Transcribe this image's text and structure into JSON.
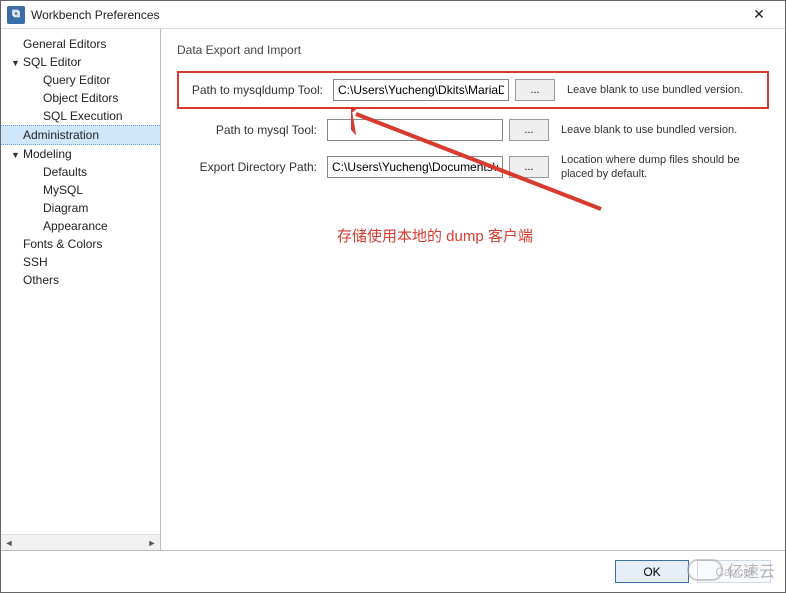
{
  "window": {
    "title": "Workbench Preferences"
  },
  "sidebar": {
    "items": [
      {
        "label": "General Editors",
        "type": "top"
      },
      {
        "label": "SQL Editor",
        "type": "branch"
      },
      {
        "label": "Query Editor",
        "type": "child"
      },
      {
        "label": "Object Editors",
        "type": "child"
      },
      {
        "label": "SQL Execution",
        "type": "child"
      },
      {
        "label": "Administration",
        "type": "top",
        "selected": true
      },
      {
        "label": "Modeling",
        "type": "branch"
      },
      {
        "label": "Defaults",
        "type": "child"
      },
      {
        "label": "MySQL",
        "type": "child"
      },
      {
        "label": "Diagram",
        "type": "child"
      },
      {
        "label": "Appearance",
        "type": "child"
      },
      {
        "label": "Fonts & Colors",
        "type": "top"
      },
      {
        "label": "SSH",
        "type": "top"
      },
      {
        "label": "Others",
        "type": "top"
      }
    ]
  },
  "section": {
    "title": "Data Export and Import"
  },
  "rows": {
    "mysqldump": {
      "label": "Path to mysqldump Tool:",
      "value": "C:\\Users\\Yucheng\\Dkits\\MariaDB\\b",
      "browse": "...",
      "help": "Leave blank to use bundled version."
    },
    "mysql": {
      "label": "Path to mysql Tool:",
      "value": "",
      "browse": "...",
      "help": "Leave blank to use bundled version."
    },
    "exportdir": {
      "label": "Export Directory Path:",
      "value": "C:\\Users\\Yucheng\\Documents\\dum",
      "browse": "...",
      "help": "Location where dump files should be placed by default."
    }
  },
  "annotation": {
    "text": "存储使用本地的 dump 客户端"
  },
  "footer": {
    "ok": "OK",
    "cancel": "Cancel"
  },
  "watermark": {
    "text": "亿速云"
  }
}
